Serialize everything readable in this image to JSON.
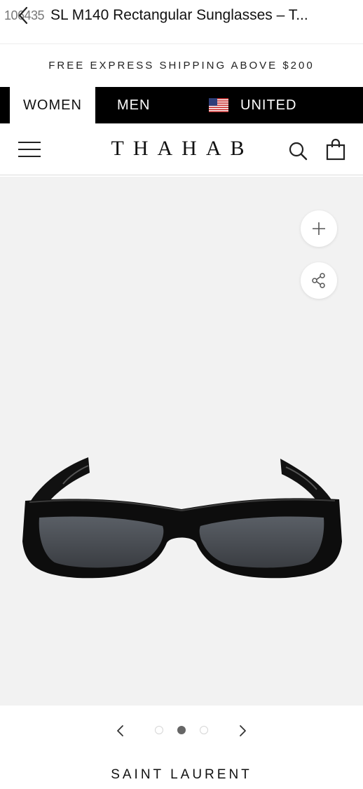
{
  "titlebar": {
    "counter": "106435",
    "title": "SL M140 Rectangular Sunglasses – T..."
  },
  "banner": {
    "shipping_text": "FREE EXPRESS SHIPPING ABOVE $200"
  },
  "gender_bar": {
    "women_label": "WOMEN",
    "men_label": "MEN",
    "country_label": "UNITED",
    "flag_icon": "us-flag-icon"
  },
  "header": {
    "logo": "THAHAB",
    "icons": [
      "menu-icon",
      "search-icon",
      "shopping-bag-icon"
    ]
  },
  "gallery": {
    "buttons": [
      "plus-icon",
      "share-icon"
    ],
    "image_alt": "black rectangular sunglasses",
    "pager": {
      "total": 3,
      "active": 2
    }
  },
  "product": {
    "brand": "SAINT LAURENT"
  },
  "colors": {
    "bar_black": "#000000",
    "gallery_bg": "#f2f2f2",
    "dot_active": "#666666"
  }
}
